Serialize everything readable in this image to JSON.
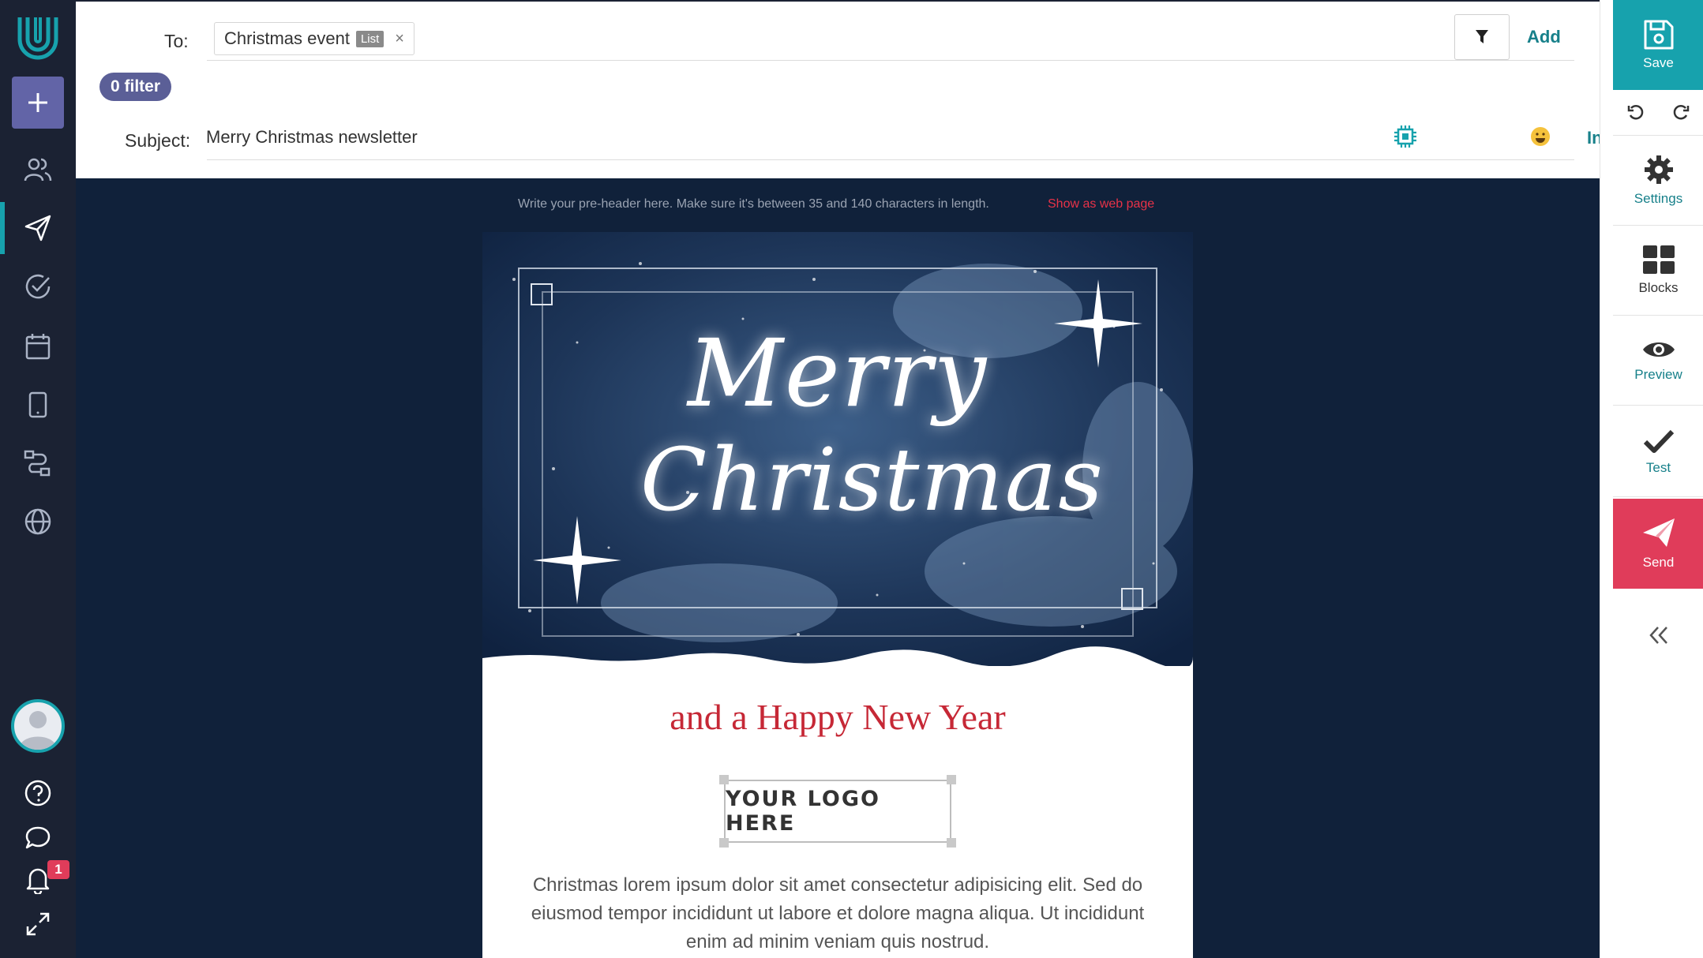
{
  "header": {
    "to_label": "To:",
    "recipient": {
      "name": "Christmas event",
      "type": "List",
      "remove": "×"
    },
    "add_label": "Add",
    "filter_count": "0 filter",
    "subject_label": "Subject:",
    "subject_value": "Merry Christmas newsletter",
    "insert_label": "Insert"
  },
  "canvas": {
    "preheader": "Write your pre-header here. Make sure it's between 35 and 140 characters in length.",
    "webpage_link": "Show as web page",
    "hero_line1": "Merry",
    "hero_line2": "Christmas",
    "subtitle": "and a Happy New Year",
    "logo_placeholder": "YOUR LOGO HERE",
    "body_text": "Christmas lorem ipsum dolor sit amet consectetur adipisicing elit. Sed do eiusmod tempor incididunt ut labore et dolore magna aliqua. Ut incididunt enim ad minim veniam quis nostrud."
  },
  "toolbar": {
    "save": "Save",
    "settings": "Settings",
    "blocks": "Blocks",
    "preview": "Preview",
    "test": "Test",
    "send": "Send"
  },
  "nav": {
    "notification_count": "1"
  },
  "colors": {
    "nav_bg": "#1b2233",
    "accent_teal": "#17a2ad",
    "send_red": "#e03c5a",
    "filter_purple": "#5b5f97",
    "subtitle_red": "#c62836",
    "canvas_bg": "#10213a"
  }
}
